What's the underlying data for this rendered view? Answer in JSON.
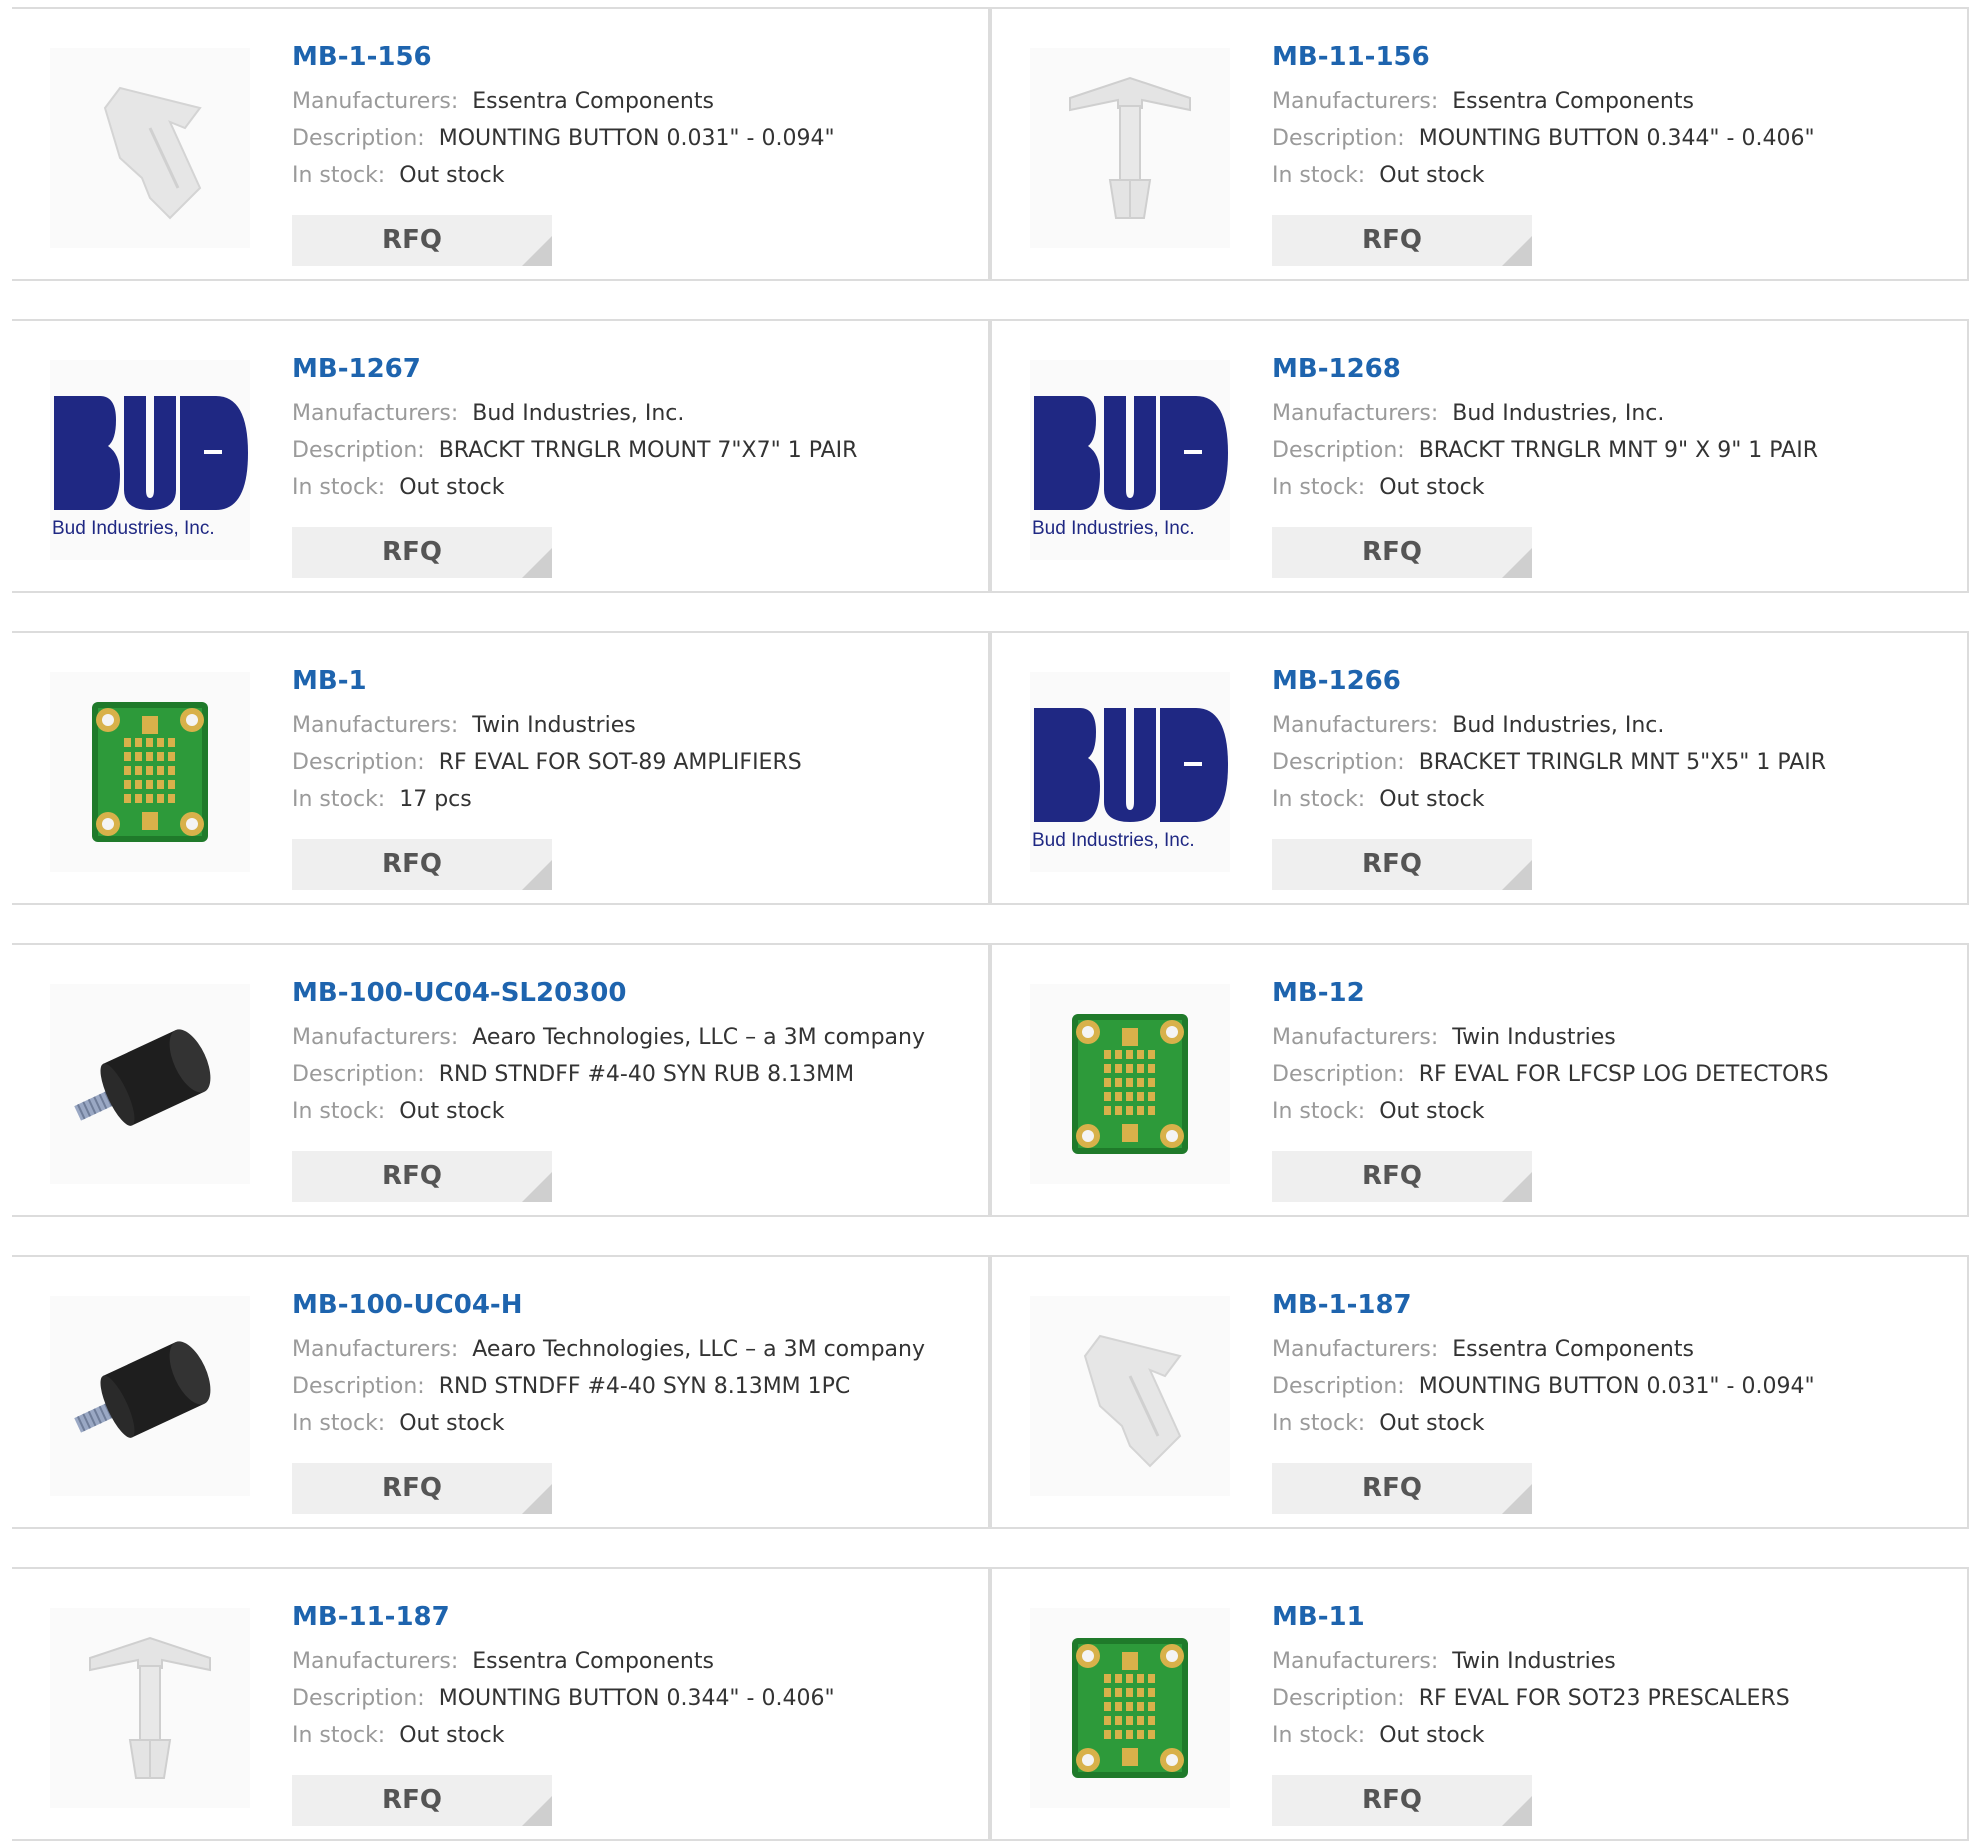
{
  "labels": {
    "manufacturer": "Manufacturers:",
    "description": "Description:",
    "stock": "In stock:",
    "rfq": "RFQ"
  },
  "products": [
    {
      "part": "MB-1-156",
      "manufacturer": "Essentra Components",
      "description": "MOUNTING BUTTON 0.031\" - 0.094\"",
      "stock": "Out stock",
      "image": "clip-icon"
    },
    {
      "part": "MB-11-156",
      "manufacturer": "Essentra Components",
      "description": "MOUNTING BUTTON 0.344\" - 0.406\"",
      "stock": "Out stock",
      "image": "standoff-icon"
    },
    {
      "part": "MB-1267",
      "manufacturer": "Bud Industries, Inc.",
      "description": "BRACKT TRNGLR MOUNT 7\"X7\" 1 PAIR",
      "stock": "Out stock",
      "image": "bud-logo"
    },
    {
      "part": "MB-1268",
      "manufacturer": "Bud Industries, Inc.",
      "description": "BRACKT TRNGLR MNT 9\" X 9\" 1 PAIR",
      "stock": "Out stock",
      "image": "bud-logo"
    },
    {
      "part": "MB-1",
      "manufacturer": "Twin Industries",
      "description": "RF EVAL FOR SOT-89 AMPLIFIERS",
      "stock": "17 pcs",
      "image": "pcb-icon"
    },
    {
      "part": "MB-1266",
      "manufacturer": "Bud Industries, Inc.",
      "description": "BRACKET TRINGLR MNT 5\"X5\" 1 PAIR",
      "stock": "Out stock",
      "image": "bud-logo"
    },
    {
      "part": "MB-100-UC04-SL20300",
      "manufacturer": "Aearo Technologies, LLC – a 3M company",
      "description": "RND STNDFF #4-40 SYN RUB 8.13MM",
      "stock": "Out stock",
      "image": "rubber-mount-icon"
    },
    {
      "part": "MB-12",
      "manufacturer": "Twin Industries",
      "description": "RF EVAL FOR LFCSP LOG DETECTORS",
      "stock": "Out stock",
      "image": "pcb-icon"
    },
    {
      "part": "MB-100-UC04-H",
      "manufacturer": "Aearo Technologies, LLC – a 3M company",
      "description": "RND STNDFF #4-40 SYN 8.13MM 1PC",
      "stock": "Out stock",
      "image": "rubber-mount-icon"
    },
    {
      "part": "MB-1-187",
      "manufacturer": "Essentra Components",
      "description": "MOUNTING BUTTON 0.031\" - 0.094\"",
      "stock": "Out stock",
      "image": "clip-icon"
    },
    {
      "part": "MB-11-187",
      "manufacturer": "Essentra Components",
      "description": "MOUNTING BUTTON 0.344\" - 0.406\"",
      "stock": "Out stock",
      "image": "standoff-icon"
    },
    {
      "part": "MB-11",
      "manufacturer": "Twin Industries",
      "description": "RF EVAL FOR SOT23 PRESCALERS",
      "stock": "Out stock",
      "image": "pcb-icon"
    }
  ],
  "bud_logo_caption": "Bud Industries, Inc.",
  "colors": {
    "link": "#1e64ae",
    "bud_navy": "#1f2883",
    "pcb_green": "#2d9a3a",
    "pad_gold": "#d8b14a"
  }
}
